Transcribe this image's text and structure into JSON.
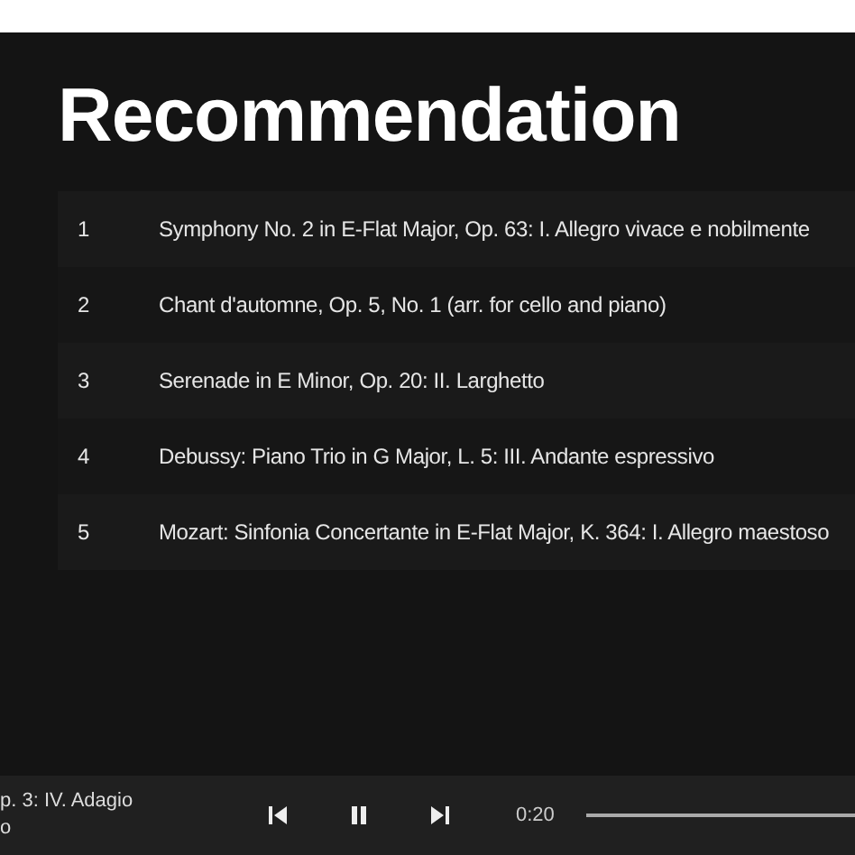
{
  "heading": "Recommendation",
  "tracks": [
    {
      "number": "1",
      "title": "Symphony No. 2 in E-Flat Major, Op. 63: I. Allegro vivace e nobilmente"
    },
    {
      "number": "2",
      "title": "Chant d'automne, Op. 5, No. 1 (arr. for cello and piano)"
    },
    {
      "number": "3",
      "title": "Serenade in E Minor, Op. 20: II. Larghetto"
    },
    {
      "number": "4",
      "title": "Debussy: Piano Trio in G Major, L. 5: III. Andante espressivo"
    },
    {
      "number": "5",
      "title": "Mozart: Sinfonia Concertante in E-Flat Major, K. 364: I. Allegro maestoso"
    }
  ],
  "player": {
    "now_playing": "p. 3: IV. Adagio",
    "artist": "o",
    "playing": true,
    "elapsed": "0:20"
  }
}
